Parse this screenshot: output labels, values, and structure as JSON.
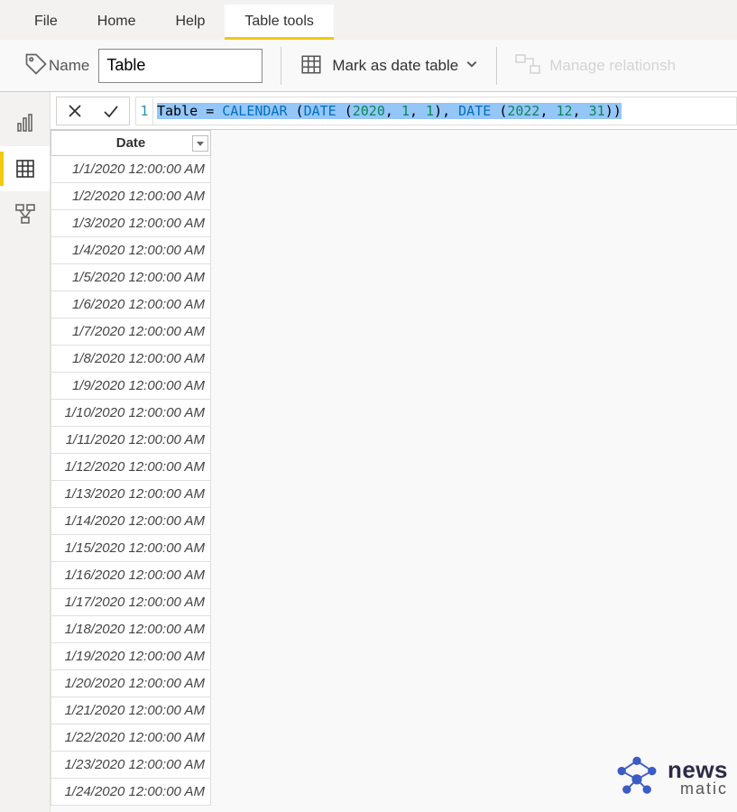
{
  "ribbon": {
    "tabs": [
      "File",
      "Home",
      "Help",
      "Table tools"
    ],
    "active_index": 3,
    "name_label": "Name",
    "name_value": "Table",
    "mark_date_label": "Mark as date table",
    "manage_rel_label": "Manage relationsh"
  },
  "formula": {
    "line_number": "1",
    "tokens": [
      {
        "t": "Table ",
        "c": "tok-plain"
      },
      {
        "t": "=",
        "c": "tok-plain"
      },
      {
        "t": " ",
        "c": "tok-plain"
      },
      {
        "t": "CALENDAR",
        "c": "tok-func"
      },
      {
        "t": " ",
        "c": "tok-plain"
      },
      {
        "t": "(",
        "c": "tok-paren"
      },
      {
        "t": "DATE",
        "c": "tok-func"
      },
      {
        "t": " ",
        "c": "tok-plain"
      },
      {
        "t": "(",
        "c": "tok-paren"
      },
      {
        "t": "2020",
        "c": "tok-num"
      },
      {
        "t": ",",
        "c": "tok-comma"
      },
      {
        "t": " ",
        "c": "tok-plain"
      },
      {
        "t": "1",
        "c": "tok-num"
      },
      {
        "t": ",",
        "c": "tok-comma"
      },
      {
        "t": " ",
        "c": "tok-plain"
      },
      {
        "t": "1",
        "c": "tok-num"
      },
      {
        "t": ")",
        "c": "tok-paren"
      },
      {
        "t": ",",
        "c": "tok-comma"
      },
      {
        "t": " ",
        "c": "tok-plain"
      },
      {
        "t": "DATE",
        "c": "tok-func"
      },
      {
        "t": " ",
        "c": "tok-plain"
      },
      {
        "t": "(",
        "c": "tok-paren"
      },
      {
        "t": "2022",
        "c": "tok-num"
      },
      {
        "t": ",",
        "c": "tok-comma"
      },
      {
        "t": " ",
        "c": "tok-plain"
      },
      {
        "t": "12",
        "c": "tok-num"
      },
      {
        "t": ",",
        "c": "tok-comma"
      },
      {
        "t": " ",
        "c": "tok-plain"
      },
      {
        "t": "31",
        "c": "tok-num"
      },
      {
        "t": ")",
        "c": "tok-paren"
      },
      {
        "t": ")",
        "c": "tok-paren"
      }
    ]
  },
  "table": {
    "column_header": "Date",
    "rows": [
      "1/1/2020 12:00:00 AM",
      "1/2/2020 12:00:00 AM",
      "1/3/2020 12:00:00 AM",
      "1/4/2020 12:00:00 AM",
      "1/5/2020 12:00:00 AM",
      "1/6/2020 12:00:00 AM",
      "1/7/2020 12:00:00 AM",
      "1/8/2020 12:00:00 AM",
      "1/9/2020 12:00:00 AM",
      "1/10/2020 12:00:00 AM",
      "1/11/2020 12:00:00 AM",
      "1/12/2020 12:00:00 AM",
      "1/13/2020 12:00:00 AM",
      "1/14/2020 12:00:00 AM",
      "1/15/2020 12:00:00 AM",
      "1/16/2020 12:00:00 AM",
      "1/17/2020 12:00:00 AM",
      "1/18/2020 12:00:00 AM",
      "1/19/2020 12:00:00 AM",
      "1/20/2020 12:00:00 AM",
      "1/21/2020 12:00:00 AM",
      "1/22/2020 12:00:00 AM",
      "1/23/2020 12:00:00 AM",
      "1/24/2020 12:00:00 AM"
    ]
  },
  "watermark": {
    "line1": "news",
    "line2": "matic"
  }
}
